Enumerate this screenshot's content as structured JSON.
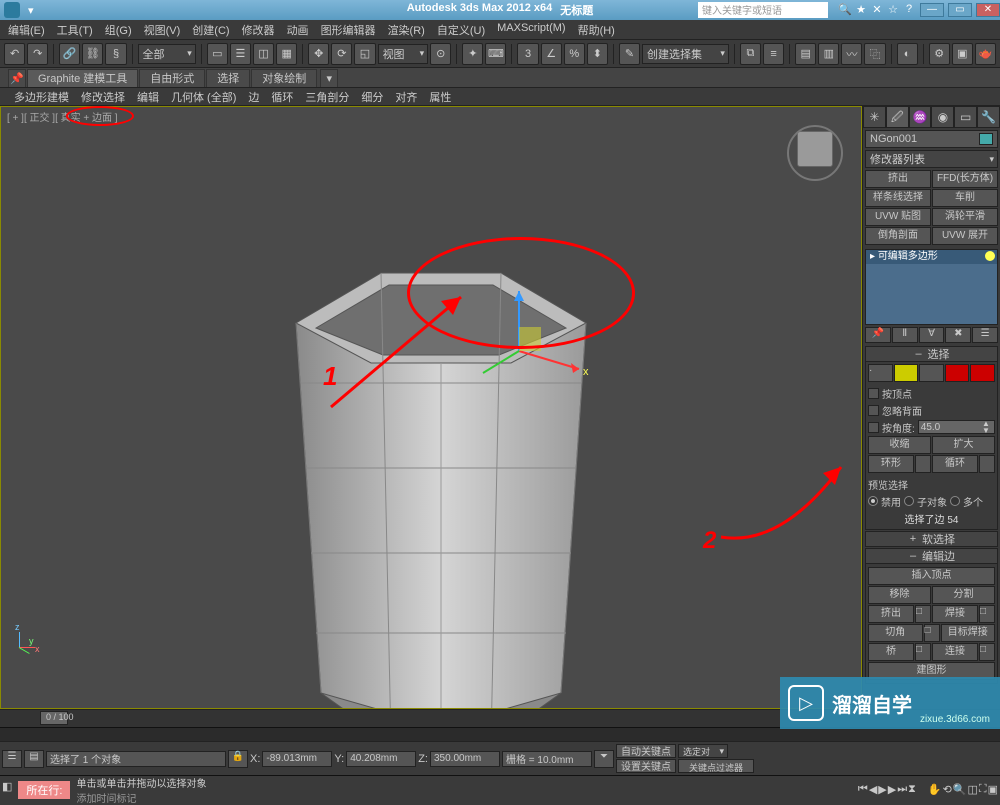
{
  "title": {
    "app": "Autodesk 3ds Max 2012 x64",
    "doc": "无标题",
    "searchPlaceholder": "键入关键字或短语"
  },
  "menu": [
    "编辑(E)",
    "工具(T)",
    "组(G)",
    "视图(V)",
    "创建(C)",
    "修改器",
    "动画",
    "图形编辑器",
    "渲染(R)",
    "自定义(U)",
    "MAXScript(M)",
    "帮助(H)"
  ],
  "toolbar": {
    "allDropdown": "全部",
    "selSetDropdown": "创建选择集",
    "viewBtn": "视图"
  },
  "ribbon": {
    "tabs": [
      "Graphite 建模工具",
      "自由形式",
      "选择",
      "对象绘制"
    ],
    "sub": [
      "多边形建模",
      "修改选择",
      "编辑",
      "几何体 (全部)",
      "边",
      "循环",
      "三角剖分",
      "细分",
      "对齐",
      "属性"
    ]
  },
  "viewport": {
    "label": "[ + ][ 正交 ][ 真实 + 边面 ]",
    "axes": {
      "x": "x",
      "y": "y",
      "z": "z"
    }
  },
  "cmd": {
    "objName": "NGon001",
    "modListLabel": "修改器列表",
    "btns": [
      [
        "挤出",
        "FFD(长方体)"
      ],
      [
        "样条线选择",
        "车削"
      ],
      [
        "UVW 贴图",
        "涡轮平滑"
      ],
      [
        "倒角剖面",
        "UVW 展开"
      ]
    ],
    "stackItem": "可编辑多边形",
    "rollouts": {
      "selection": {
        "title": "选择",
        "byVertex": "按顶点",
        "ignoreBackfacing": "忽略背面",
        "byAngle": "按角度:",
        "angleValue": "45.0",
        "shrink": "收缩",
        "grow": "扩大",
        "ring": "环形",
        "loop": "循环",
        "previewSel": "预览选择",
        "off": "禁用",
        "subObj": "子对象",
        "multi": "多个",
        "info": "选择了边 54"
      },
      "softSel": "软选择",
      "editEdges": {
        "title": "编辑边",
        "insertVertex": "插入顶点",
        "remove": "移除",
        "split": "分割",
        "extrude": "挤出",
        "weld": "焊接",
        "chamfer": "切角",
        "targetWeld": "目标焊接",
        "bridge": "桥",
        "connect": "连接",
        "createShape": "建图形"
      }
    }
  },
  "timeline": {
    "range": "0 / 100"
  },
  "status": {
    "selected": "选择了 1 个对象",
    "x": "-89.013mm",
    "y": "40.208mm",
    "z": "350.00mm",
    "xLabel": "X:",
    "yLabel": "Y:",
    "zLabel": "Z:",
    "grid": "栅格 = 10.0mm",
    "autoKey": "自动关键点",
    "selKey": "选定对",
    "setKey": "设置关键点",
    "keyFilter": "关键点过滤器"
  },
  "prompt": {
    "tag": "所在行:",
    "line1": "单击或单击并拖动以选择对象",
    "line2": "添加时间标记"
  },
  "watermark": {
    "brand": "溜溜自学",
    "url": "zixue.3d66.com"
  },
  "annotations": {
    "num1": "1",
    "num2": "2"
  }
}
